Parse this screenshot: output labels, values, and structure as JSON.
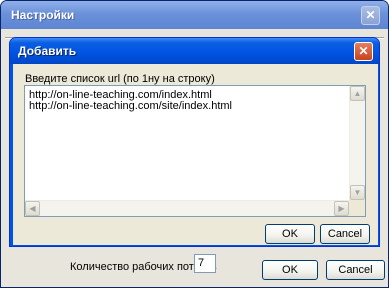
{
  "outer_window": {
    "title": "Настройки",
    "close_glyph": "✕",
    "threads_label": "Количество рабочих потоков",
    "threads_value": "7",
    "ok_label": "OK",
    "cancel_label": "Cancel"
  },
  "dialog": {
    "title": "Добавить",
    "close_glyph": "✕",
    "prompt": "Введите список url (по 1ну на строку)",
    "urls": [
      "http://on-line-teaching.com/index.html",
      "http://on-line-teaching.com/site/index.html"
    ],
    "ok_label": "OK",
    "cancel_label": "Cancel",
    "scroll": {
      "up_glyph": "▲",
      "down_glyph": "▼",
      "left_glyph": "◀",
      "right_glyph": "▶"
    }
  },
  "colors": {
    "dialog_titlebar": "#0054e3",
    "outer_titlebar_inactive": "#6b91da",
    "window_face": "#ece9d8",
    "close_button": "#c8431d"
  }
}
